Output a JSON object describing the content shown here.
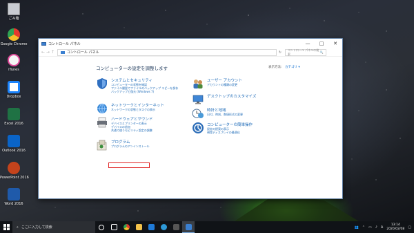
{
  "desktop": {
    "icons": [
      {
        "label": "ごみ箱",
        "icon": "recycle-bin-icon",
        "color": "#c9ccd2"
      },
      {
        "label": "Google Chrome",
        "icon": "chrome-icon",
        "color": "#e33b2e"
      },
      {
        "label": "iTunes",
        "icon": "itunes-icon",
        "color": "#f1f1f1"
      },
      {
        "label": "Dropbox",
        "icon": "dropbox-icon",
        "color": "#1a82fb"
      },
      {
        "label": "Excel 2016",
        "icon": "excel-icon",
        "color": "#1f7244"
      },
      {
        "label": "Outlook 2016",
        "icon": "outlook-icon",
        "color": "#0a64c8"
      },
      {
        "label": "PowerPoint 2016",
        "icon": "powerpoint-icon",
        "color": "#c4431c"
      },
      {
        "label": "Word 2016",
        "icon": "word-icon",
        "color": "#1f5aaa"
      }
    ]
  },
  "window": {
    "title": "コントロール パネル",
    "min_glyph": "—",
    "max_glyph": "□",
    "close_glyph": "✕",
    "breadcrumb": "コントロール パネル",
    "back_glyph": "←  →  ↑",
    "refresh_glyph": "↻",
    "search_placeholder": "コントロール パネルの検索",
    "search_icon": "🔍"
  },
  "content": {
    "heading": "コンピューターの設定を調整します",
    "viewby_label": "表示方法:",
    "viewby_value": "カテゴリ ▾",
    "categories_left": [
      {
        "title": "システムとセキュリティ",
        "icon": "shield-icon",
        "links": [
          "コンピューターの状態を確認",
          "ファイル履歴でファイルのバックアップ コピーを保存",
          "バックアップと復元 (Windows 7)"
        ]
      },
      {
        "title": "ネットワークとインターネット",
        "icon": "network-icon",
        "links": [
          "ネットワークの状態とタスクの表示"
        ]
      },
      {
        "title": "ハードウェアとサウンド",
        "icon": "printer-icon",
        "links": [
          "デバイスとプリンターの表示",
          "デバイスの追加",
          "共通で使うモビリティ設定の調整"
        ]
      },
      {
        "title": "プログラム",
        "icon": "programs-icon",
        "links": [
          "プログラムのアンインストール"
        ]
      }
    ],
    "categories_right": [
      {
        "title": "ユーザー アカウント",
        "icon": "users-icon",
        "links": [
          "アカウントの種類の変更"
        ]
      },
      {
        "title": "デスクトップのカスタマイズ",
        "icon": "desktop-icon",
        "links": []
      },
      {
        "title": "時計と地域",
        "icon": "clock-region-icon",
        "links": [
          "日付、時刻、数値形式の変更"
        ]
      },
      {
        "title": "コンピューターの簡単操作",
        "icon": "ease-of-access-icon",
        "links": [
          "設定の提案の表示",
          "視覚ディスプレイの最適化"
        ]
      }
    ]
  },
  "taskbar": {
    "search_placeholder": "ここに入力して検索",
    "time": "13:14",
    "date": "2020/02/08",
    "ime": "A"
  }
}
